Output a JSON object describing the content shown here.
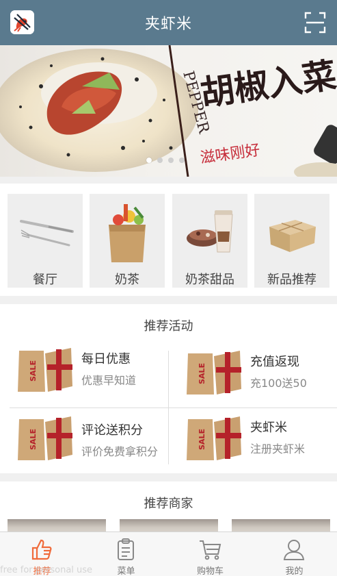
{
  "header": {
    "title": "夹虾米",
    "logo_icon": "shrimp-chopsticks-icon",
    "scan_icon": "scan-icon",
    "bg_color": "#5a7a8e"
  },
  "banner": {
    "headline": "胡椒入菜",
    "en_text": "PEPPER",
    "tagline": "滋味刚好",
    "dots_total": 4,
    "dots_active": 1
  },
  "categories": [
    {
      "label": "餐厅",
      "icon": "knife-fork-icon"
    },
    {
      "label": "奶茶",
      "icon": "grocery-bag-icon"
    },
    {
      "label": "奶茶甜品",
      "icon": "dessert-drink-icon"
    },
    {
      "label": "新品推荐",
      "icon": "gift-box-icon"
    }
  ],
  "promotions": {
    "title": "推荐活动",
    "items": [
      {
        "name": "每日优惠",
        "desc": "优惠早知道",
        "icon": "sale-bags-icon"
      },
      {
        "name": "充值返现",
        "desc": "充100送50",
        "icon": "sale-bags-icon"
      },
      {
        "name": "评论送积分",
        "desc": "评价免费拿积分",
        "icon": "sale-bags-icon"
      },
      {
        "name": "夹虾米",
        "desc": "注册夹虾米",
        "icon": "sale-bags-icon"
      }
    ],
    "sale_text": "SALE",
    "sale_color": "#b5222a"
  },
  "merchants": {
    "title": "推荐商家"
  },
  "tabbar": {
    "active_color": "#f06a3a",
    "tabs": [
      {
        "label": "推荐",
        "icon": "thumbs-up-icon",
        "active": true
      },
      {
        "label": "菜单",
        "icon": "clipboard-icon",
        "active": false
      },
      {
        "label": "购物车",
        "icon": "cart-icon",
        "active": false
      },
      {
        "label": "我的",
        "icon": "user-icon",
        "active": false
      }
    ]
  },
  "watermark": "free for personal use"
}
